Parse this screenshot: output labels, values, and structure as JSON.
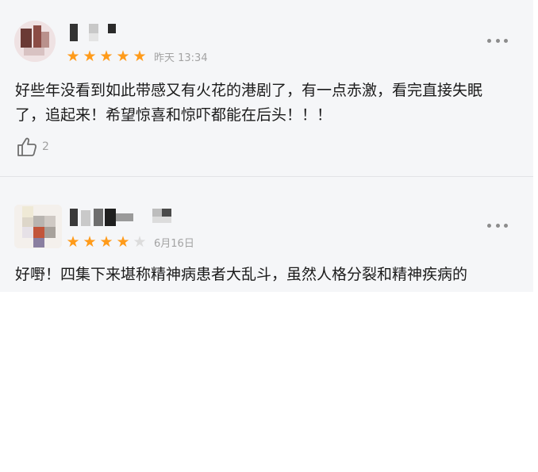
{
  "reviews": [
    {
      "time": "昨天 13:34",
      "rating": 5,
      "text": "好些年没看到如此带感又有火花的港剧了，有一点赤激，看完直接失眠了，追起来！希望惊喜和惊吓都能在后头！！！",
      "likes": "2",
      "icons": {
        "more": "more-dots-icon",
        "like": "thumbs-up-icon",
        "star": "star-icon"
      }
    },
    {
      "time": "6月16日",
      "rating": 4,
      "text": "好嘢！四集下来堪称精神病患者大乱斗，虽然人格分裂和精神疾病的",
      "icons": {
        "more": "more-dots-icon",
        "star": "star-icon"
      }
    }
  ],
  "colors": {
    "star_on": "#ff9b1a",
    "star_off": "#dcdcdc",
    "feed_bg": "#f5f6f8",
    "time": "#a3a3a3"
  }
}
